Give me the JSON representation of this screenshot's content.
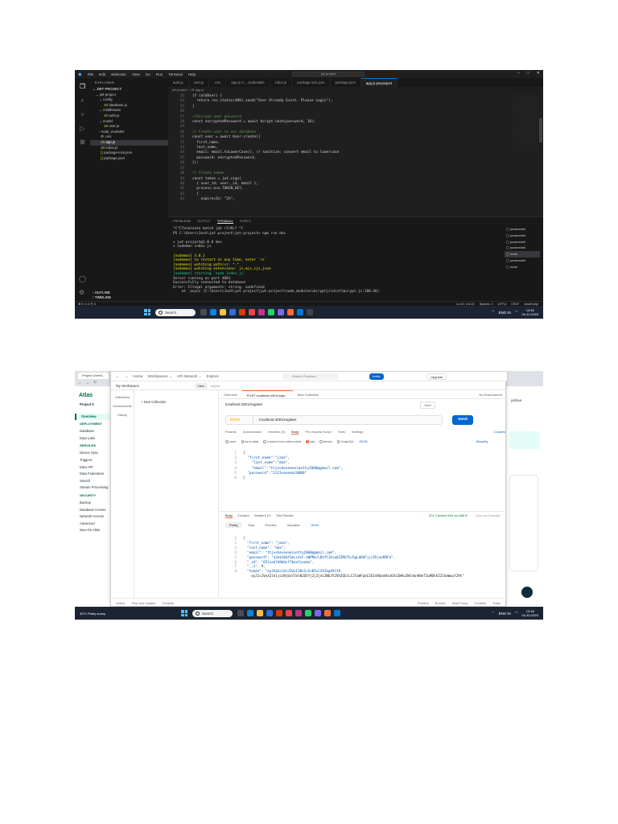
{
  "vscode": {
    "menu": [
      "File",
      "Edit",
      "Selection",
      "View",
      "Go",
      "Run",
      "Terminal",
      "Help"
    ],
    "title": "jwt project",
    "tabs": [
      "auth.js",
      "user.js",
      ".env",
      "app.js C:...credentials",
      "index.js",
      "package-lock.json",
      "package.json",
      "app.js jwt-project"
    ],
    "active_tab": "app.js jwt-project",
    "breadcrumb": "jwt-project > JS app.js",
    "explorer": {
      "header": "EXPLORER",
      "root": "JWT PROJECT",
      "items": [
        "jwt-project",
        "config",
        "database.js",
        "middleware",
        "auth.js",
        "model",
        "user.js",
        "node_modules",
        ".env",
        "app.js",
        "index.js",
        "package-lock.json",
        "package.json"
      ],
      "selected": "app.js",
      "footer": [
        "OUTLINE",
        "TIMELINE"
      ]
    },
    "line_numbers": [
      "23",
      "24",
      "25",
      "26",
      "27",
      "28",
      "29",
      "30",
      "31",
      "32",
      "33",
      "34",
      "35",
      "36",
      "37",
      "38",
      "39",
      "40",
      "41",
      "42",
      "43"
    ],
    "code_lines": [
      "if (oldUser) {",
      "  return res.status(409).send(\"User Already Exist. Please Login\");",
      "}",
      "",
      "//Encrypt user password",
      "const encryptedPassword = await bcrypt.hash(password, 10);",
      "",
      "// Create user in our database",
      "const user = await User.create({",
      "  first_name,",
      "  last_name,",
      "  email: email.toLowerCase(), // sanitize: convert email to lowercase",
      "  password: encryptedPassword,",
      "});",
      "",
      "// Create token",
      "const token = jwt.sign(",
      "  { user_id: user._id, email },",
      "  process.env.TOKEN_KEY,",
      "  {",
      "    expiresIn: \"2h\","
    ],
    "panel_tabs": [
      "PROBLEMS",
      "OUTPUT",
      "TERMINAL",
      "PORTS"
    ],
    "active_panel_tab": "TERMINAL",
    "terminal_lines": [
      "^C^CTerminate batch job (Y/N)? ^C",
      "PS C:\\Users\\Josh\\jwt project\\jwt-project> npm run dev",
      "",
      "> jwt-project@1.0.0 dev",
      "> nodemon index.js",
      "",
      "[nodemon] 3.0.1",
      "[nodemon] to restart at any time, enter `rs`",
      "[nodemon] watching path(s): *.*",
      "[nodemon] watching extensions: js,mjs,cjs,json",
      "[nodemon] starting `node index.js`",
      "Server running on port 4001",
      "Successfully connected to database",
      "Error: Illegal arguments: string, undefined",
      "    at _async (C:\\Users\\Josh\\jwt project\\jwt-project\\node_modules\\bcryptjs\\dist\\bcrypt.js:286:46)"
    ],
    "shells": [
      "powershell",
      "powershell",
      "powershell",
      "powershell",
      "node",
      "powershell",
      "node"
    ],
    "status_left": "⊗ 0 ⚠ 0  ⓦ 0",
    "status_right": [
      "Ln 40, Col 22",
      "Spaces: 2",
      "UTF-8",
      "CRLF",
      "JavaScript"
    ]
  },
  "taskbar_top": {
    "search": "Search",
    "lang": "ENG IN",
    "time": "13:34",
    "date": "04-10-2023"
  },
  "postman": {
    "browser_tab": "Project Overvi...",
    "nav": [
      "Home",
      "Workspaces",
      "API Network",
      "Explore"
    ],
    "search_placeholder": "Search Postman",
    "invite": "Invite",
    "upgrade": "Upgrade",
    "workspace": "My Workspace",
    "new": "New",
    "import": "Import",
    "rail": [
      "Collections",
      "Environments",
      "History"
    ],
    "new_collection": "+  New Collection",
    "request_tabs": [
      "Overview",
      "POST localhost:4001/regis...",
      "New Collection"
    ],
    "environment": "No Environment",
    "request_title": "localhost:4001/register",
    "save": "Save",
    "method": "POST",
    "url": "localhost:4001/register",
    "send": "Send",
    "options": [
      "Params",
      "Authorization",
      "Headers (9)",
      "Body",
      "Pre-request Script",
      "Tests",
      "Settings"
    ],
    "active_option": "Body",
    "cookies": "Cookies",
    "body_types": [
      "none",
      "form-data",
      "x-www-form-urlencoded",
      "raw",
      "binary",
      "GraphQL"
    ],
    "active_body_type": "raw",
    "format": "JSON",
    "beautify": "Beautify",
    "req_ln": [
      "1",
      "2",
      "3",
      "4",
      "5",
      "6"
    ],
    "req_code": [
      "{",
      "  \"first_name\":\"jane\",",
      "    \"last_name\":\"doe\",",
      "    \"email\":\"ttjosheseeneiantty2008@gmail.com\",",
      "  \"password\":\"1123seeneai0000\"",
      "}"
    ],
    "res_tabs": [
      "Body",
      "Cookies",
      "Headers (7)",
      "Test Results"
    ],
    "status": "201 Created  548 ms  888 B",
    "save_example": "Save as Example",
    "view_tabs": [
      "Pretty",
      "Raw",
      "Preview",
      "Visualize"
    ],
    "res_format": "JSON",
    "res_ln": [
      "1",
      "2",
      "3",
      "4",
      "5",
      "6",
      "7",
      "8",
      ""
    ],
    "res_code": [
      "{",
      "  \"first_name\": \"jane\",",
      "  \"last_name\": \"doe\",",
      "  \"email\": \"ttjosheseeneiantty2008@gmail.com\",",
      "  \"password\": \"$2a$10$Y3mcs4cF.nWPMe/LDhfFJ6iqV2ZRU7S/EgLmRdFjjsZhjeeRRFa\",",
      "  \"_id\": \"651ceb7d9b6cf7bea7ceada\",",
      "  \"__v\": 0,",
      "  \"token\": \"eyJhbGciOiJIUzI1NiIsInR5cCI6IkpXVCJ9.",
      "    eyJ1c2VyX2lkIjoiNjUxY2ViN2Q5YjZjZjdiZWE3Y2VhZGEiLCJlbWFpbCI6InR0am9zaGVzZWVuZWlhbnR0eTIwMDhAZ21haWwuY29t\""
    ],
    "footer": [
      "Online",
      "Find and replace",
      "Console",
      "Postbot",
      "Runner",
      "Start Proxy",
      "Cookies",
      "Trash"
    ],
    "atlas": {
      "logo": "Atlas",
      "project": "Project 0",
      "items": [
        {
          "t": "Overview",
          "k": "sel"
        },
        {
          "t": "DEPLOYMENT",
          "k": "hd"
        },
        {
          "t": "Database",
          "k": "it"
        },
        {
          "t": "Data Lake",
          "k": "it"
        },
        {
          "t": "SERVICES",
          "k": "hd"
        },
        {
          "t": "Device Sync",
          "k": "it"
        },
        {
          "t": "Triggers",
          "k": "it"
        },
        {
          "t": "Data API",
          "k": "it"
        },
        {
          "t": "Data Federation",
          "k": "it"
        },
        {
          "t": "Search",
          "k": "it"
        },
        {
          "t": "Stream Processing",
          "k": "it"
        },
        {
          "t": "SECURITY",
          "k": "hd"
        },
        {
          "t": "Backup",
          "k": "it"
        },
        {
          "t": "Database Access",
          "k": "it"
        },
        {
          "t": "Network Access",
          "k": "it"
        },
        {
          "t": "Advanced",
          "k": "it"
        },
        {
          "t": "New On Atlas",
          "k": "it"
        }
      ],
      "user": "joshua"
    }
  },
  "taskbar_bottom": {
    "weather": "30°C Partly sunny",
    "search": "Search",
    "lang": "ENG IN",
    "time": "13:18",
    "date": "04-10-2023"
  }
}
